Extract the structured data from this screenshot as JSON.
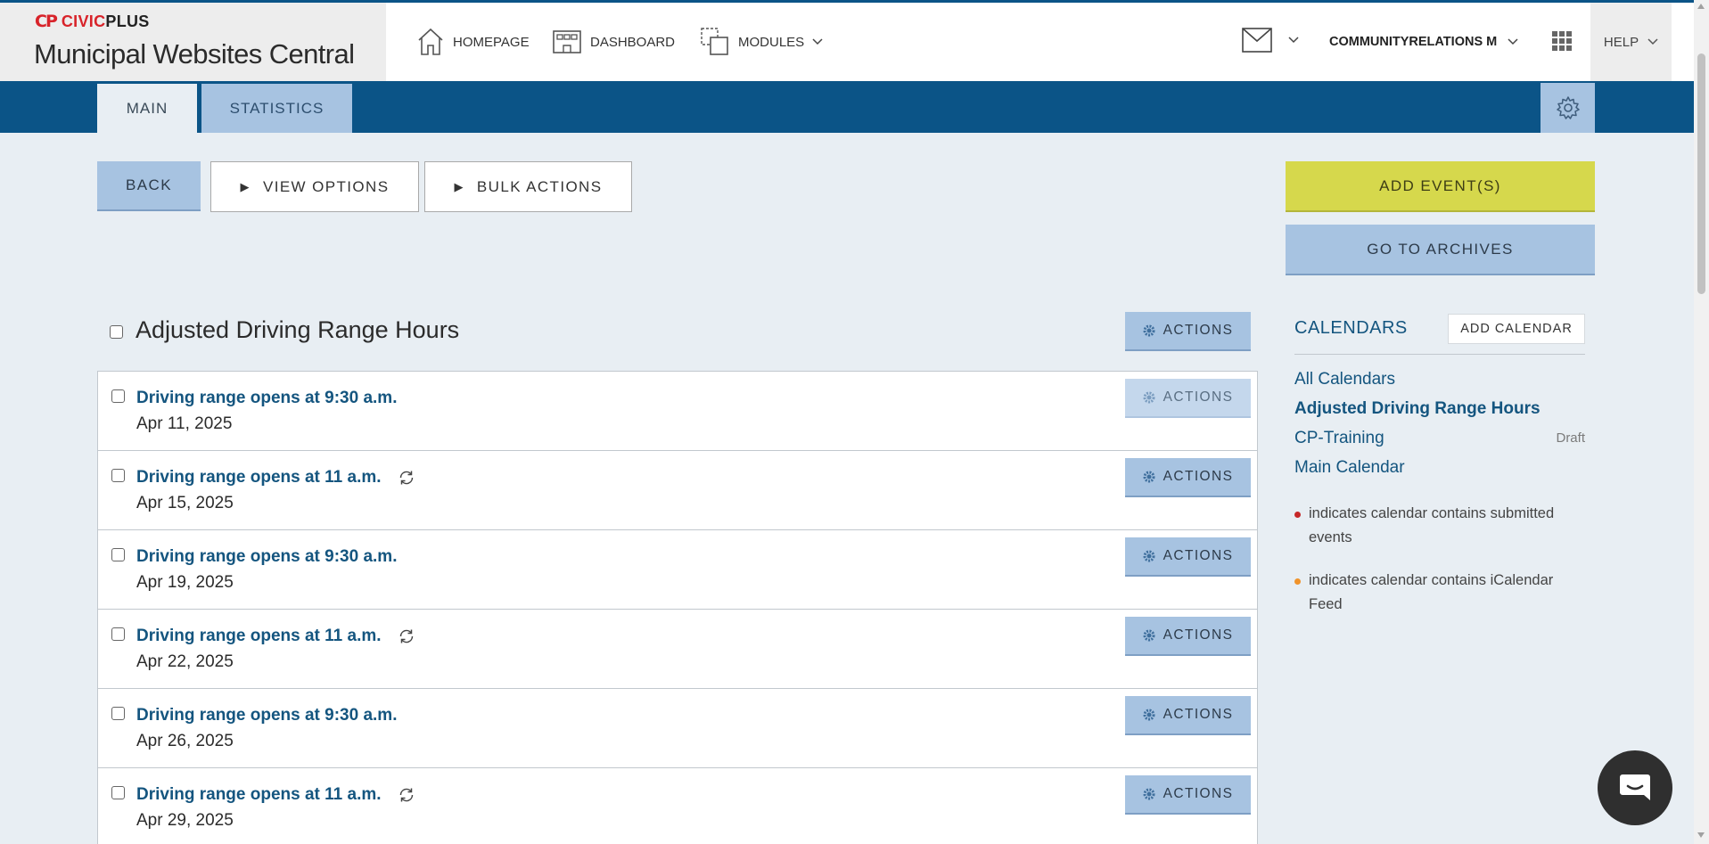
{
  "brand": {
    "logo_mark": "CP",
    "logo_civic": "CIVIC",
    "logo_plus": "PLUS",
    "title": "Municipal Websites Central"
  },
  "nav": {
    "homepage": "HOMEPAGE",
    "dashboard": "DASHBOARD",
    "modules": "MODULES"
  },
  "user": {
    "name": "COMMUNITYRELATIONS M"
  },
  "help": {
    "label": "HELP"
  },
  "tabs": {
    "main": "MAIN",
    "statistics": "STATISTICS"
  },
  "toolbar": {
    "back": "BACK",
    "view_options": "VIEW OPTIONS",
    "bulk_actions": "BULK ACTIONS",
    "add_events": "ADD EVENT(S)",
    "go_to_archives": "GO TO ARCHIVES"
  },
  "calendar": {
    "title": "Adjusted Driving Range Hours",
    "actions_label": "ACTIONS"
  },
  "events": [
    {
      "title": "Driving range opens at 9:30 a.m.",
      "date": "Apr 11, 2025",
      "recurring": false
    },
    {
      "title": "Driving range opens at 11 a.m.",
      "date": "Apr 15, 2025",
      "recurring": true
    },
    {
      "title": "Driving range opens at 9:30 a.m.",
      "date": "Apr 19, 2025",
      "recurring": false
    },
    {
      "title": "Driving range opens at 11 a.m.",
      "date": "Apr 22, 2025",
      "recurring": true
    },
    {
      "title": "Driving range opens at 9:30 a.m.",
      "date": "Apr 26, 2025",
      "recurring": false
    },
    {
      "title": "Driving range opens at 11 a.m.",
      "date": "Apr 29, 2025",
      "recurring": true
    }
  ],
  "sidebar": {
    "title": "CALENDARS",
    "add_calendar": "ADD CALENDAR",
    "calendars": [
      {
        "name": "All Calendars",
        "status": ""
      },
      {
        "name": "Adjusted Driving Range Hours",
        "status": ""
      },
      {
        "name": "CP-Training",
        "status": "Draft"
      },
      {
        "name": "Main Calendar",
        "status": ""
      }
    ],
    "legend": [
      {
        "text": "indicates calendar contains submitted events",
        "color": "#c62828"
      },
      {
        "text": "indicates calendar contains iCalendar Feed",
        "color": "#f0932b"
      }
    ]
  },
  "colors": {
    "header_blue": "#0b5487",
    "link_blue": "#14557f",
    "button_blue": "#a7c3e1",
    "add_yellow": "#d6d84c"
  },
  "icons": [
    "house-icon",
    "dashboard-icon",
    "modules-icon",
    "mail-icon",
    "apps-grid-icon",
    "gear-icon",
    "recurring-icon",
    "chat-icon"
  ]
}
